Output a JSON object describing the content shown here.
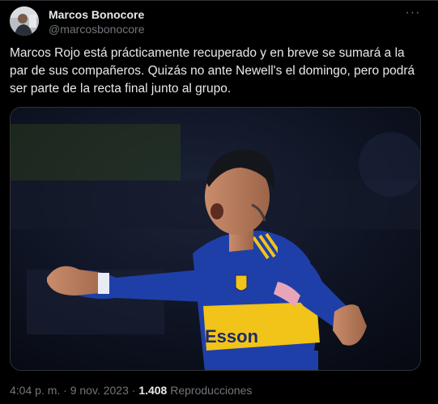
{
  "author": {
    "name": "Marcos Bonocore",
    "handle": "@marcosbonocore"
  },
  "more_label": "···",
  "tweet_text": "Marcos Rojo está prácticamente recuperado y en breve se sumará a la par de sus compañeros. Quizás no ante Newell's el domingo, pero podrá ser parte de la recta final junto al grupo.",
  "media": {
    "jersey_sponsor": "Esson"
  },
  "meta": {
    "time": "4:04 p. m.",
    "separator1": "·",
    "date": "9 nov. 2023",
    "separator2": "·",
    "views_count": "1.408",
    "views_label": "Reproducciones"
  },
  "colors": {
    "background": "#000000",
    "text": "#e7e9ea",
    "secondary": "#71767b",
    "jersey_blue": "#1f3fa8",
    "jersey_yellow": "#f2c318"
  }
}
